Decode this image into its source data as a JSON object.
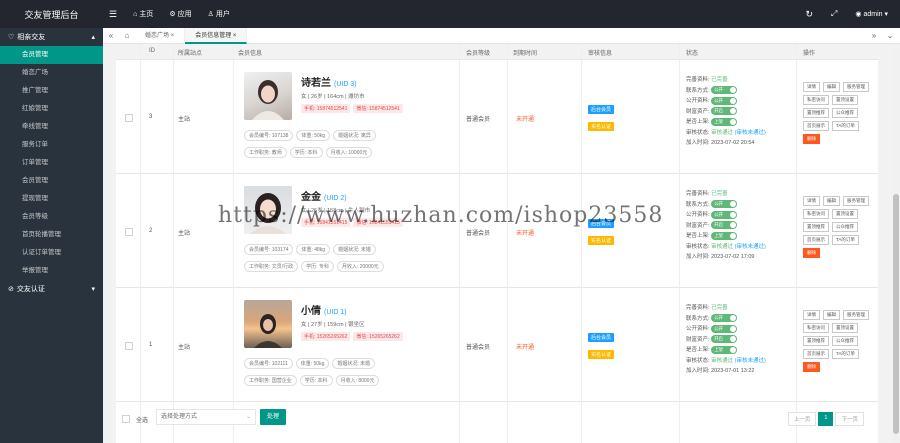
{
  "app": {
    "title": "交友管理后台"
  },
  "topnav": [
    {
      "icon": "menu-icon",
      "label": ""
    },
    {
      "icon": "home-icon",
      "label": "主页"
    },
    {
      "icon": "app-icon",
      "label": "应用"
    },
    {
      "icon": "user-icon",
      "label": "用户"
    }
  ],
  "topright": {
    "user": "admin",
    "refresh_icon": "refresh-icon",
    "fullscreen_icon": "fullscreen-icon"
  },
  "sidebar": {
    "group1": "相亲交友",
    "items": [
      "会员管理",
      "婚恋广场",
      "推广管理",
      "红娘管理",
      "牵线管理",
      "服务订单",
      "订单管理",
      "会员管理",
      "提现管理",
      "会员等级",
      "首页轮播管理",
      "认证订单管理",
      "举报管理"
    ],
    "active_index": 0,
    "group2": "交友认证"
  },
  "tabs": {
    "items": [
      "婚恋广场",
      "会员信息管理"
    ],
    "current": 1
  },
  "table": {
    "headers": [
      "ID",
      "所属站点",
      "会员信息",
      "会员等级",
      "到期时间",
      "审核信息",
      "状态",
      "操作"
    ],
    "rows": [
      {
        "id": "3",
        "site": "主站",
        "name": "诗若兰",
        "uid": "(UID 3)",
        "info": "女 | 26岁 | 164cm | 潍坊市",
        "phone1": "手机: 15874512541",
        "phone2": "微信: 15874512541",
        "tags1": [
          "会员编号: 107138",
          "体重: 50kg",
          "婚姻状况: 离异"
        ],
        "tags2": [
          "工作职务: 教师",
          "学历: 本科",
          "月收入: 10000元"
        ],
        "level": "普通会员",
        "expire": "未开通",
        "badge1": "后台会员",
        "badge2": "实名认证",
        "status": {
          "reg": "完善资料:",
          "reg_val": "已完善",
          "contact": "联系方式:",
          "contact_toggle": "公开",
          "public": "公开资料:",
          "public_toggle": "公开",
          "wealth": "财富资产:",
          "wealth_toggle": "开启",
          "online": "是否上架:",
          "online_toggle": "上架",
          "audit": "审核状态:",
          "audit_val": "审核通过",
          "audit_extra": "(审核未通过)",
          "join": "加入时间:",
          "join_val": "2023-07-02 20:54"
        },
        "ops": [
          "详情",
          "编辑",
          "服务管理",
          "私密访问",
          "置顶设置",
          "置顶推荐",
          "公众推荐",
          "首页展示",
          "TA的订单",
          "删除"
        ]
      },
      {
        "id": "2",
        "site": "主站",
        "name": "金金",
        "uid": "(UID 2)",
        "info": "女 | 26岁 | 158cm | 牛人副市",
        "phone1": "手机: 16841551415",
        "phone2": "微信: 16841551415",
        "tags1": [
          "会员编号: 103174",
          "体重: 48kg",
          "婚姻状况: 未婚"
        ],
        "tags2": [
          "工作职务: 文员/行政",
          "学历: 专科",
          "月收入: 20000元"
        ],
        "level": "普通会员",
        "expire": "未开通",
        "badge1": "后台会员",
        "badge2": "实名认证",
        "status": {
          "reg": "完善资料:",
          "reg_val": "已完善",
          "contact": "联系方式:",
          "contact_toggle": "公开",
          "public": "公开资料:",
          "public_toggle": "公开",
          "wealth": "财富资产:",
          "wealth_toggle": "开启",
          "online": "是否上架:",
          "online_toggle": "上架",
          "audit": "审核状态:",
          "audit_val": "审核通过",
          "audit_extra": "(审核未通过)",
          "join": "加入时间:",
          "join_val": "2023-07-02 17:09"
        },
        "ops": [
          "详情",
          "编辑",
          "服务管理",
          "私密访问",
          "置顶设置",
          "置顶推荐",
          "公众推荐",
          "首页展示",
          "TA的订单",
          "删除"
        ]
      },
      {
        "id": "1",
        "site": "主站",
        "name": "小倩",
        "uid": "(UID 1)",
        "info": "女 | 27岁 | 159cm | 银坐区",
        "phone1": "手机: 15265265262",
        "phone2": "微信: 15265265262",
        "tags1": [
          "会员编号: 102111",
          "体重: 50kg",
          "婚姻状况: 未婚"
        ],
        "tags2": [
          "工作职务: 国营企业",
          "学历: 本科",
          "月收入: 8000元"
        ],
        "level": "普通会员",
        "expire": "未开通",
        "badge1": "后台会员",
        "badge2": "实名认证",
        "status": {
          "reg": "完善资料:",
          "reg_val": "已完善",
          "contact": "联系方式:",
          "contact_toggle": "公开",
          "public": "公开资料:",
          "public_toggle": "公开",
          "wealth": "财富资产:",
          "wealth_toggle": "开启",
          "online": "是否上架:",
          "online_toggle": "上架",
          "audit": "审核状态:",
          "audit_val": "审核通过",
          "audit_extra": "(审核未通过)",
          "join": "加入时间:",
          "join_val": "2023-07-01 13:22"
        },
        "ops": [
          "详情",
          "编辑",
          "服务管理",
          "私密访问",
          "置顶设置",
          "置顶推荐",
          "公众推荐",
          "首页展示",
          "TA的订单",
          "删除"
        ]
      }
    ]
  },
  "footer": {
    "select_all": "全选",
    "select_placeholder": "选择处理方式",
    "submit": "处理",
    "prev": "上一页",
    "page": "1",
    "next": "下一页"
  },
  "watermark": "https://www.huzhan.com/ishop23558",
  "colors": {
    "accent": "#009688",
    "topbar": "#23262e",
    "sidebar": "#28333e",
    "danger": "#ff5722",
    "info": "#1e9fff",
    "warn": "#ffb800",
    "ok": "#5fb878"
  }
}
